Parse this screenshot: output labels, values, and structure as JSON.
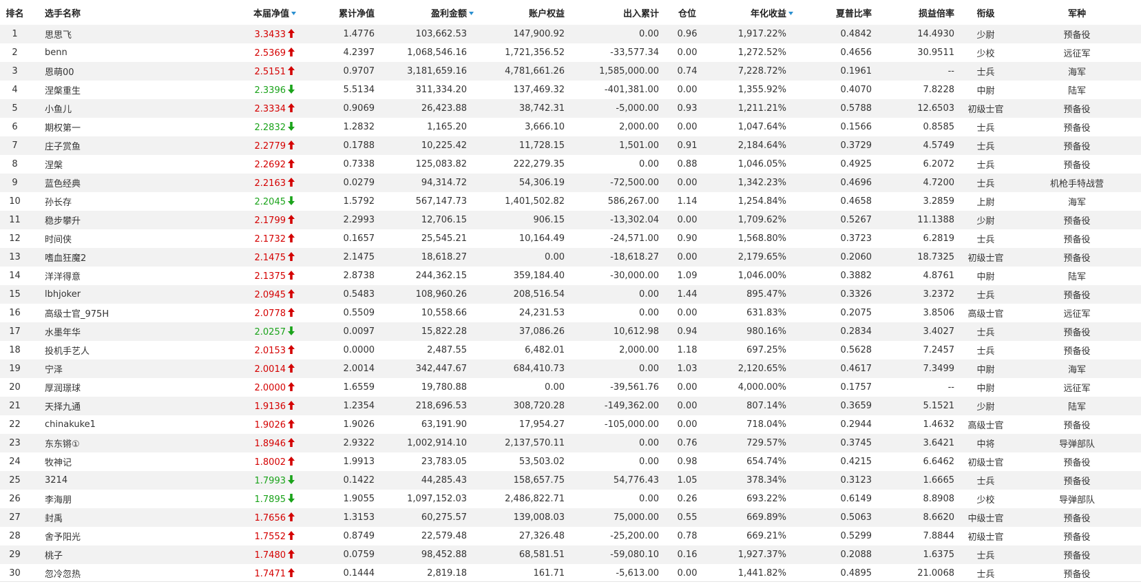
{
  "colors": {
    "up": "#d40000",
    "down": "#1aa31a",
    "sort_indicator": "#2a8fd0",
    "row_alt": "#f2f2f2"
  },
  "headers": [
    "排名",
    "选手名称",
    "本届净值",
    "累计净值",
    "盈利金额",
    "账户权益",
    "出入累计",
    "仓位",
    "年化收益",
    "夏普比率",
    "损益倍率",
    "衔级",
    "军种"
  ],
  "sort_icon": "sort-desc-triangle-icon",
  "rows": [
    {
      "rank": "1",
      "name": "思思飞",
      "nav": "3.3433",
      "trend": "up",
      "cum": "1.4776",
      "profit": "103,662.53",
      "equity": "147,900.92",
      "flow": "0.00",
      "pos": "0.96",
      "annual": "1,917.22%",
      "sharpe": "0.4842",
      "ratio": "14.4930",
      "grade": "少尉",
      "branch": "预备役"
    },
    {
      "rank": "2",
      "name": "benn",
      "nav": "2.5369",
      "trend": "up",
      "cum": "4.2397",
      "profit": "1,068,546.16",
      "equity": "1,721,356.52",
      "flow": "-33,577.34",
      "pos": "0.00",
      "annual": "1,272.52%",
      "sharpe": "0.4656",
      "ratio": "30.9511",
      "grade": "少校",
      "branch": "远征军"
    },
    {
      "rank": "3",
      "name": "恩萌00",
      "nav": "2.5151",
      "trend": "up",
      "cum": "0.9707",
      "profit": "3,181,659.16",
      "equity": "4,781,661.26",
      "flow": "1,585,000.00",
      "pos": "0.74",
      "annual": "7,228.72%",
      "sharpe": "0.1961",
      "ratio": "--",
      "grade": "士兵",
      "branch": "海军"
    },
    {
      "rank": "4",
      "name": "涅槃重生",
      "nav": "2.3396",
      "trend": "down",
      "cum": "5.5134",
      "profit": "311,334.20",
      "equity": "137,469.32",
      "flow": "-401,381.00",
      "pos": "0.00",
      "annual": "1,355.92%",
      "sharpe": "0.4070",
      "ratio": "7.8228",
      "grade": "中尉",
      "branch": "陆军"
    },
    {
      "rank": "5",
      "name": "小鱼儿",
      "nav": "2.3334",
      "trend": "up",
      "cum": "0.9069",
      "profit": "26,423.88",
      "equity": "38,742.31",
      "flow": "-5,000.00",
      "pos": "0.93",
      "annual": "1,211.21%",
      "sharpe": "0.5788",
      "ratio": "12.6503",
      "grade": "初级士官",
      "branch": "预备役"
    },
    {
      "rank": "6",
      "name": "期权第一",
      "nav": "2.2832",
      "trend": "down",
      "cum": "1.2832",
      "profit": "1,165.20",
      "equity": "3,666.10",
      "flow": "2,000.00",
      "pos": "0.00",
      "annual": "1,047.64%",
      "sharpe": "0.1566",
      "ratio": "0.8585",
      "grade": "士兵",
      "branch": "预备役"
    },
    {
      "rank": "7",
      "name": "庄子赏鱼",
      "nav": "2.2779",
      "trend": "up",
      "cum": "0.1788",
      "profit": "10,225.42",
      "equity": "11,728.15",
      "flow": "1,501.00",
      "pos": "0.91",
      "annual": "2,184.64%",
      "sharpe": "0.3729",
      "ratio": "4.5749",
      "grade": "士兵",
      "branch": "预备役"
    },
    {
      "rank": "8",
      "name": "涅槃",
      "nav": "2.2692",
      "trend": "up",
      "cum": "0.7338",
      "profit": "125,083.82",
      "equity": "222,279.35",
      "flow": "0.00",
      "pos": "0.88",
      "annual": "1,046.05%",
      "sharpe": "0.4925",
      "ratio": "6.2072",
      "grade": "士兵",
      "branch": "预备役"
    },
    {
      "rank": "9",
      "name": "蓝色经典",
      "nav": "2.2163",
      "trend": "up",
      "cum": "0.0279",
      "profit": "94,314.72",
      "equity": "54,306.19",
      "flow": "-72,500.00",
      "pos": "0.00",
      "annual": "1,342.23%",
      "sharpe": "0.4696",
      "ratio": "4.7200",
      "grade": "士兵",
      "branch": "机枪手特战营"
    },
    {
      "rank": "10",
      "name": "孙长存",
      "nav": "2.2045",
      "trend": "down",
      "cum": "1.5792",
      "profit": "567,147.73",
      "equity": "1,401,502.82",
      "flow": "586,267.00",
      "pos": "1.14",
      "annual": "1,254.84%",
      "sharpe": "0.4658",
      "ratio": "3.2859",
      "grade": "上尉",
      "branch": "海军"
    },
    {
      "rank": "11",
      "name": "稳步攀升",
      "nav": "2.1799",
      "trend": "up",
      "cum": "2.2993",
      "profit": "12,706.15",
      "equity": "906.15",
      "flow": "-13,302.04",
      "pos": "0.00",
      "annual": "1,709.62%",
      "sharpe": "0.5267",
      "ratio": "11.1388",
      "grade": "少尉",
      "branch": "预备役"
    },
    {
      "rank": "12",
      "name": "时间侠",
      "nav": "2.1732",
      "trend": "up",
      "cum": "0.1657",
      "profit": "25,545.21",
      "equity": "10,164.49",
      "flow": "-24,571.00",
      "pos": "0.90",
      "annual": "1,568.80%",
      "sharpe": "0.3723",
      "ratio": "6.2819",
      "grade": "士兵",
      "branch": "预备役"
    },
    {
      "rank": "13",
      "name": "嗜血狂魔2",
      "nav": "2.1475",
      "trend": "up",
      "cum": "2.1475",
      "profit": "18,618.27",
      "equity": "0.00",
      "flow": "-18,618.27",
      "pos": "0.00",
      "annual": "2,179.65%",
      "sharpe": "0.2060",
      "ratio": "18.7325",
      "grade": "初级士官",
      "branch": "预备役"
    },
    {
      "rank": "14",
      "name": "洋洋得意",
      "nav": "2.1375",
      "trend": "up",
      "cum": "2.8738",
      "profit": "244,362.15",
      "equity": "359,184.40",
      "flow": "-30,000.00",
      "pos": "1.09",
      "annual": "1,046.00%",
      "sharpe": "0.3882",
      "ratio": "4.8761",
      "grade": "中尉",
      "branch": "陆军"
    },
    {
      "rank": "15",
      "name": "lbhjoker",
      "nav": "2.0945",
      "trend": "up",
      "cum": "0.5483",
      "profit": "108,960.26",
      "equity": "208,516.54",
      "flow": "0.00",
      "pos": "1.44",
      "annual": "895.47%",
      "sharpe": "0.3326",
      "ratio": "3.2372",
      "grade": "士兵",
      "branch": "预备役"
    },
    {
      "rank": "16",
      "name": "高级士官_975H",
      "nav": "2.0778",
      "trend": "up",
      "cum": "0.5509",
      "profit": "10,558.66",
      "equity": "24,231.53",
      "flow": "0.00",
      "pos": "0.00",
      "annual": "631.83%",
      "sharpe": "0.2075",
      "ratio": "3.8506",
      "grade": "高级士官",
      "branch": "远征军"
    },
    {
      "rank": "17",
      "name": "水墨年华",
      "nav": "2.0257",
      "trend": "down",
      "cum": "0.0097",
      "profit": "15,822.28",
      "equity": "37,086.26",
      "flow": "10,612.98",
      "pos": "0.94",
      "annual": "980.16%",
      "sharpe": "0.2834",
      "ratio": "3.4027",
      "grade": "士兵",
      "branch": "预备役"
    },
    {
      "rank": "18",
      "name": "投机手艺人",
      "nav": "2.0153",
      "trend": "up",
      "cum": "0.0000",
      "profit": "2,487.55",
      "equity": "6,482.01",
      "flow": "2,000.00",
      "pos": "1.18",
      "annual": "697.25%",
      "sharpe": "0.5628",
      "ratio": "7.2457",
      "grade": "士兵",
      "branch": "预备役"
    },
    {
      "rank": "19",
      "name": "宁泽",
      "nav": "2.0014",
      "trend": "up",
      "cum": "2.0014",
      "profit": "342,447.67",
      "equity": "684,410.73",
      "flow": "0.00",
      "pos": "1.03",
      "annual": "2,120.65%",
      "sharpe": "0.4617",
      "ratio": "7.3499",
      "grade": "中尉",
      "branch": "海军"
    },
    {
      "rank": "20",
      "name": "厚润璟球",
      "nav": "2.0000",
      "trend": "up",
      "cum": "1.6559",
      "profit": "19,780.88",
      "equity": "0.00",
      "flow": "-39,561.76",
      "pos": "0.00",
      "annual": "4,000.00%",
      "sharpe": "0.1757",
      "ratio": "--",
      "grade": "中尉",
      "branch": "远征军"
    },
    {
      "rank": "21",
      "name": "天择九通",
      "nav": "1.9136",
      "trend": "up",
      "cum": "1.2354",
      "profit": "218,696.53",
      "equity": "308,720.28",
      "flow": "-149,362.00",
      "pos": "0.00",
      "annual": "807.14%",
      "sharpe": "0.3659",
      "ratio": "5.1521",
      "grade": "少尉",
      "branch": "陆军"
    },
    {
      "rank": "22",
      "name": "chinakuke1",
      "nav": "1.9026",
      "trend": "up",
      "cum": "1.9026",
      "profit": "63,191.90",
      "equity": "17,954.27",
      "flow": "-105,000.00",
      "pos": "0.00",
      "annual": "718.04%",
      "sharpe": "0.2944",
      "ratio": "1.4632",
      "grade": "高级士官",
      "branch": "预备役"
    },
    {
      "rank": "23",
      "name": "东东锵①",
      "nav": "1.8946",
      "trend": "up",
      "cum": "2.9322",
      "profit": "1,002,914.10",
      "equity": "2,137,570.11",
      "flow": "0.00",
      "pos": "0.76",
      "annual": "729.57%",
      "sharpe": "0.3745",
      "ratio": "3.6421",
      "grade": "中将",
      "branch": "导弹部队"
    },
    {
      "rank": "24",
      "name": "牧神记",
      "nav": "1.8002",
      "trend": "up",
      "cum": "1.9913",
      "profit": "23,783.05",
      "equity": "53,503.02",
      "flow": "0.00",
      "pos": "0.98",
      "annual": "654.74%",
      "sharpe": "0.4215",
      "ratio": "6.6462",
      "grade": "初级士官",
      "branch": "预备役"
    },
    {
      "rank": "25",
      "name": "3214",
      "nav": "1.7993",
      "trend": "down",
      "cum": "0.1422",
      "profit": "44,285.43",
      "equity": "158,657.75",
      "flow": "54,776.43",
      "pos": "1.05",
      "annual": "378.34%",
      "sharpe": "0.3123",
      "ratio": "1.6665",
      "grade": "士兵",
      "branch": "预备役"
    },
    {
      "rank": "26",
      "name": "李海朋",
      "nav": "1.7895",
      "trend": "down",
      "cum": "1.9055",
      "profit": "1,097,152.03",
      "equity": "2,486,822.71",
      "flow": "0.00",
      "pos": "0.26",
      "annual": "693.22%",
      "sharpe": "0.6149",
      "ratio": "8.8908",
      "grade": "少校",
      "branch": "导弹部队"
    },
    {
      "rank": "27",
      "name": "封禹",
      "nav": "1.7656",
      "trend": "up",
      "cum": "1.3153",
      "profit": "60,275.57",
      "equity": "139,008.03",
      "flow": "75,000.00",
      "pos": "0.55",
      "annual": "669.89%",
      "sharpe": "0.5063",
      "ratio": "8.6620",
      "grade": "中级士官",
      "branch": "预备役"
    },
    {
      "rank": "28",
      "name": "舍予阳光",
      "nav": "1.7552",
      "trend": "up",
      "cum": "0.8749",
      "profit": "22,579.48",
      "equity": "27,326.48",
      "flow": "-25,200.00",
      "pos": "0.78",
      "annual": "669.21%",
      "sharpe": "0.5299",
      "ratio": "7.8844",
      "grade": "初级士官",
      "branch": "预备役"
    },
    {
      "rank": "29",
      "name": "桃子",
      "nav": "1.7480",
      "trend": "up",
      "cum": "0.0759",
      "profit": "98,452.88",
      "equity": "68,581.51",
      "flow": "-59,080.10",
      "pos": "0.16",
      "annual": "1,927.37%",
      "sharpe": "0.2088",
      "ratio": "1.6375",
      "grade": "士兵",
      "branch": "预备役"
    },
    {
      "rank": "30",
      "name": "忽冷忽热",
      "nav": "1.7471",
      "trend": "up",
      "cum": "0.1444",
      "profit": "2,819.18",
      "equity": "161.71",
      "flow": "-5,613.00",
      "pos": "0.00",
      "annual": "1,441.82%",
      "sharpe": "0.4895",
      "ratio": "21.0068",
      "grade": "士兵",
      "branch": "预备役"
    }
  ]
}
